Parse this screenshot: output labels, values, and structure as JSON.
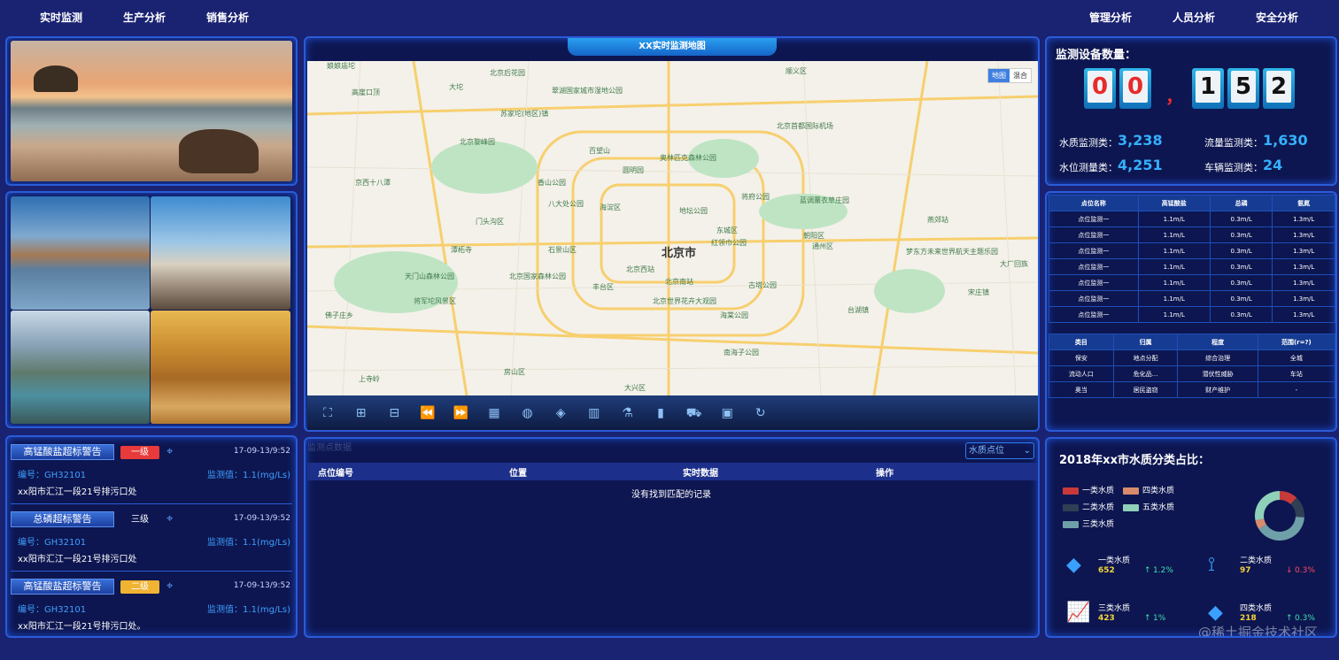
{
  "nav": {
    "left": [
      "实时监测",
      "生产分析",
      "销售分析"
    ],
    "right": [
      "管理分析",
      "人员分析",
      "安全分析"
    ]
  },
  "alerts": [
    {
      "title": "高锰酸盐超标警告",
      "level": "一级",
      "level_color": "#e83a3a",
      "time": "17-09-13/9:52",
      "code": "编号：GH32101",
      "value": "监测值：1.1(mg/Ls)",
      "address": "xx阳市汇江一段21号排污口处"
    },
    {
      "title": "总磷超标警告",
      "level": "三级",
      "level_color": "",
      "time": "17-09-13/9:52",
      "code": "编号：GH32101",
      "value": "监测值：1.1(mg/Ls)",
      "address": "xx阳市汇江一段21号排污口处"
    },
    {
      "title": "高锰酸盐超标警告",
      "level": "二级",
      "level_color": "#f1b332",
      "time": "17-09-13/9:52",
      "code": "编号：GH32101",
      "value": "监测值：1.1(mg/Ls)",
      "address": "xx阳市汇江一段21号排污口处。"
    }
  ],
  "map": {
    "title": "XX实时监测地图",
    "type_buttons": [
      "地图",
      "混合"
    ],
    "city_label": "北京市",
    "labels": [
      "娘娘庙坨",
      "北京后花园",
      "大坨",
      "顺义区",
      "高崖口顶",
      "翠湖国家城市湿地公园",
      "苏家坨(地区)镇",
      "北京首都国际机场",
      "北京黎峰园",
      "奥林匹克森林公园",
      "百望山",
      "圆明园",
      "京西十八潭",
      "香山公园",
      "八大处公园",
      "海淀区",
      "地坛公园",
      "将府公园",
      "蓝调薰衣草庄园",
      "燕郊站",
      "门头沟区",
      "东城区",
      "红领巾公园",
      "潭柘寺",
      "石景山区",
      "北京西站",
      "朝阳区",
      "通州区",
      "梦东方未来世界航天主题乐园",
      "天门山森林公园",
      "北京国家森林公园",
      "北京南站",
      "古塔公园",
      "丰台区",
      "将军坨风景区",
      "北京世界花卉大观园",
      "海棠公园",
      "大厂回族",
      "佛子庄乡",
      "南海子公园",
      "上寺岭",
      "房山区",
      "大兴区",
      "宋庄镇",
      "台湖镇"
    ]
  },
  "toolbar_icons": [
    "fullscreen-icon",
    "zoom-in-icon",
    "zoom-out-icon",
    "rewind-icon",
    "forward-icon",
    "map-icon",
    "globe-icon",
    "money-icon",
    "building-icon",
    "flask-icon",
    "chart-icon",
    "truck-icon",
    "window-icon",
    "refresh-icon"
  ],
  "bottom_table": {
    "faint_label": "监测点数据",
    "select_value": "水质点位",
    "headers": [
      "点位编号",
      "位置",
      "实时数据",
      "操作"
    ],
    "empty": "没有找到匹配的记录"
  },
  "stats": {
    "title": "监测设备数量：",
    "digits": [
      "0",
      "0",
      "1",
      "5",
      "2"
    ],
    "comma": "，",
    "items": [
      {
        "label": "水质监测类：",
        "value": "3,238"
      },
      {
        "label": "流量监测类：",
        "value": "1,630"
      },
      {
        "label": "水位测量类：",
        "value": "4,251"
      },
      {
        "label": "车辆监测类：",
        "value": "24"
      }
    ]
  },
  "right_table1": {
    "headers": [
      "点位名称",
      "高锰酸盐",
      "总磷",
      "氨氮"
    ],
    "rows": [
      [
        "点位监测一",
        "1.1m/L",
        "0.3m/L",
        "1.3m/L"
      ],
      [
        "点位监测一",
        "1.1m/L",
        "0.3m/L",
        "1.3m/L"
      ],
      [
        "点位监测一",
        "1.1m/L",
        "0.3m/L",
        "1.3m/L"
      ],
      [
        "点位监测一",
        "1.1m/L",
        "0.3m/L",
        "1.3m/L"
      ],
      [
        "点位监测一",
        "1.1m/L",
        "0.3m/L",
        "1.3m/L"
      ],
      [
        "点位监测一",
        "1.1m/L",
        "0.3m/L",
        "1.3m/L"
      ],
      [
        "点位监测一",
        "1.1m/L",
        "0.3m/L",
        "1.3m/L"
      ]
    ]
  },
  "right_table2": {
    "headers": [
      "类目",
      "归属",
      "程度",
      "范围(r=?)"
    ],
    "rows": [
      [
        "保安",
        "地点分配",
        "综合治理",
        "全城"
      ],
      [
        "流动人口",
        "危化品...",
        "潜伏性威胁",
        "车站"
      ],
      [
        "奥当",
        "居民盗窃",
        "财产维护",
        "-"
      ]
    ]
  },
  "water": {
    "title": "2018年xx市水质分类占比：",
    "legend": [
      {
        "name": "一类水质",
        "color": "#c83a3a"
      },
      {
        "name": "四类水质",
        "color": "#d98b6e"
      },
      {
        "name": "二类水质",
        "color": "#2f3f55"
      },
      {
        "name": "五类水质",
        "color": "#8fd0b8"
      },
      {
        "name": "三类水质",
        "color": "#6f9fa8"
      }
    ],
    "donut": [
      {
        "name": "一类水质",
        "value": 12,
        "color": "#c83a3a"
      },
      {
        "name": "二类水质",
        "value": 14,
        "color": "#2f3f55"
      },
      {
        "name": "三类水质",
        "value": 40,
        "color": "#6f9fa8"
      },
      {
        "name": "四类水质",
        "value": 6,
        "color": "#d98b6e"
      },
      {
        "name": "五类水质",
        "value": 28,
        "color": "#8fd0b8"
      }
    ],
    "cards": [
      {
        "icon": "layers-icon",
        "name": "一类水质",
        "value": "652",
        "change": "1.2%",
        "dir": "up",
        "arrow": "↑"
      },
      {
        "icon": "network-icon",
        "name": "二类水质",
        "value": "97",
        "change": "0.3%",
        "dir": "down",
        "arrow": "↓"
      },
      {
        "icon": "line-chart-icon",
        "name": "三类水质",
        "value": "423",
        "change": "1%",
        "dir": "up",
        "arrow": "↑"
      },
      {
        "icon": "layers-icon",
        "name": "四类水质",
        "value": "218",
        "change": "0.3%",
        "dir": "up",
        "arrow": "↑"
      }
    ]
  },
  "watermark": "@稀土掘金技术社区",
  "colors": {
    "accent": "#35b0ff",
    "up": "#3fe0b0",
    "down": "#ff4a5a",
    "value_yellow": "#f5d33a"
  }
}
